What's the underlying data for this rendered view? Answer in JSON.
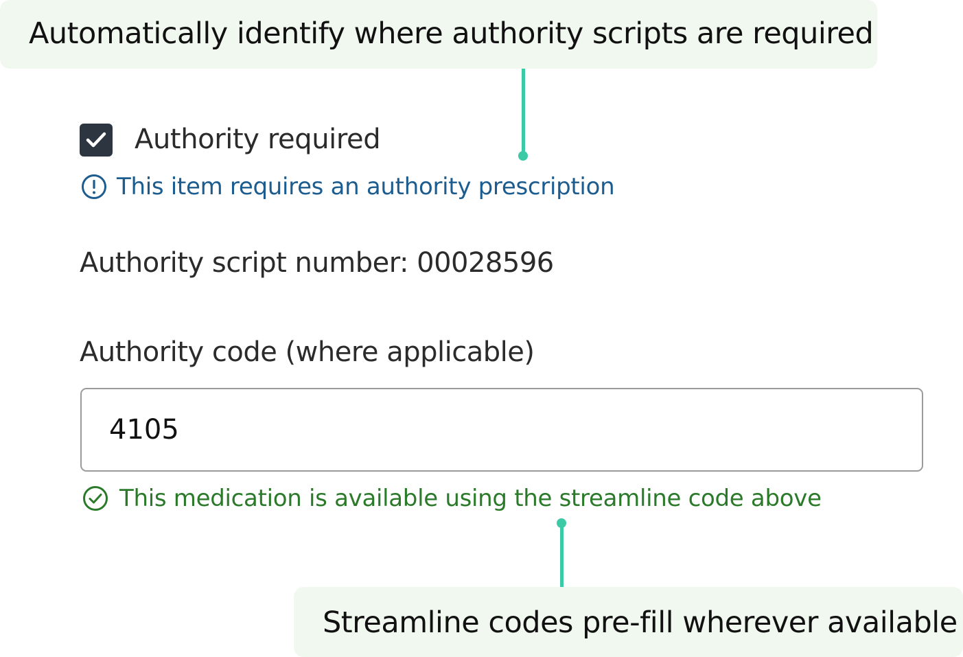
{
  "callouts": {
    "top": "Automatically identify where authority scripts are required",
    "bottom": "Streamline codes pre-fill wherever available"
  },
  "form": {
    "authority_required": {
      "label": "Authority required",
      "checked": true
    },
    "authority_notice": "This item requires an authority prescription",
    "script_number_text": "Authority script number: 00028596",
    "authority_code": {
      "label": "Authority code (where applicable)",
      "value": "4105"
    },
    "streamline_notice": "This medication is available using the streamline code above"
  },
  "icons": {
    "checkbox": "check-icon",
    "info": "info-circle-icon",
    "success": "check-circle-icon"
  },
  "colors": {
    "callout_bg": "#f1f8ef",
    "connector": "#3cc9a5",
    "info": "#1c5c8e",
    "success": "#2a7a2a",
    "checkbox": "#2d3540"
  }
}
